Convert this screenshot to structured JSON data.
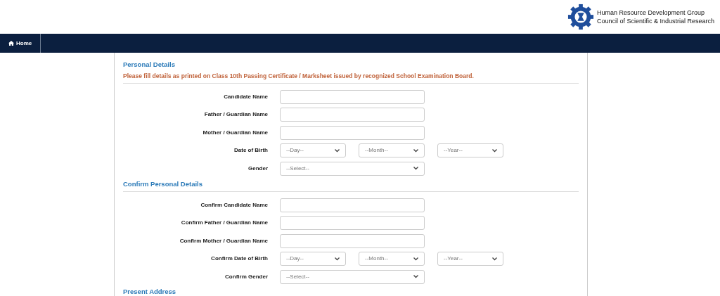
{
  "header": {
    "org_lines": [
      "Human Resource Development Group",
      "Council of Scientific & Industrial Research"
    ]
  },
  "nav": {
    "items": [
      {
        "label": "Home"
      }
    ]
  },
  "sections": [
    {
      "title": "Personal Details",
      "note": "Please fill details as printed on Class 10th Passing Certificate / Marksheet issued by recognized School Examination Board.",
      "fields": [
        {
          "kind": "text",
          "label": "Candidate Name"
        },
        {
          "kind": "text",
          "label": "Father / Guardian Name"
        },
        {
          "kind": "text",
          "label": "Mother / Guardian Name"
        },
        {
          "kind": "date",
          "label": "Date of Birth",
          "selects": [
            "--Day--",
            "--Month--",
            "--Year--"
          ]
        },
        {
          "kind": "select",
          "label": "Gender",
          "selects": [
            "--Select--"
          ]
        }
      ]
    },
    {
      "title": "Confirm Personal Details",
      "fields": [
        {
          "kind": "text",
          "label": "Confirm Candidate Name"
        },
        {
          "kind": "text",
          "label": "Confirm Father / Guardian Name"
        },
        {
          "kind": "text",
          "label": "Confirm Mother / Guardian Name"
        },
        {
          "kind": "date",
          "label": "Confirm Date of Birth",
          "selects": [
            "--Day--",
            "--Month--",
            "--Year--"
          ]
        },
        {
          "kind": "select",
          "label": "Confirm Gender",
          "selects": [
            "--Select--"
          ]
        }
      ]
    },
    {
      "title": "Present Address"
    }
  ]
}
